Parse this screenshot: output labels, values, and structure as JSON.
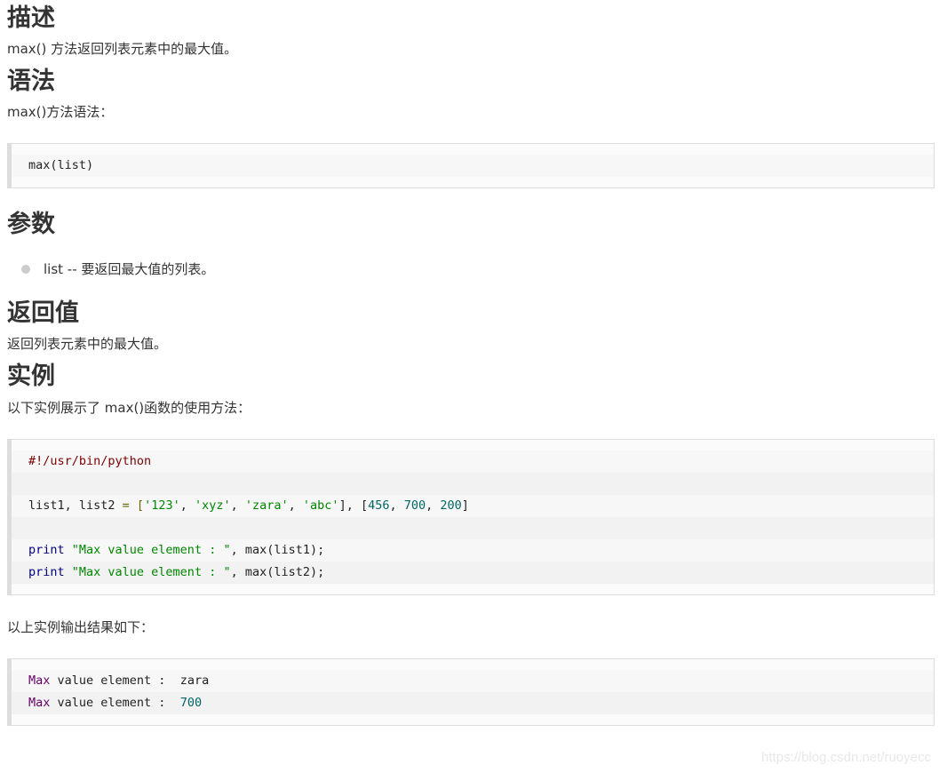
{
  "sections": {
    "description": {
      "heading": "描述",
      "text": "max() 方法返回列表元素中的最大值。"
    },
    "syntax": {
      "heading": "语法",
      "text": "max()方法语法：",
      "code": "max(list)"
    },
    "parameters": {
      "heading": "参数",
      "items": [
        {
          "text": "list -- 要返回最大值的列表。"
        }
      ]
    },
    "return_value": {
      "heading": "返回值",
      "text": "返回列表元素中的最大值。"
    },
    "example": {
      "heading": "实例",
      "text": "以下实例展示了 max()函数的使用方法：",
      "code": {
        "line1": "#!/usr/bin/python",
        "line3_a": "list1, list2 ",
        "line3_b": "= [",
        "line3_s1": "'123'",
        "line3_c1": ", ",
        "line3_s2": "'xyz'",
        "line3_c2": ", ",
        "line3_s3": "'zara'",
        "line3_c3": ", ",
        "line3_s4": "'abc'",
        "line3_d": "], [",
        "line3_n1": "456",
        "line3_c4": ", ",
        "line3_n2": "700",
        "line3_c5": ", ",
        "line3_n3": "200",
        "line3_e": "]",
        "line5_kw": "print",
        "line5_str": " \"Max value element : \"",
        "line5_rest": ", max(list1);",
        "line6_kw": "print",
        "line6_str": " \"Max value element : \"",
        "line6_rest": ", max(list2);"
      },
      "output_intro": "以上实例输出结果如下：",
      "output": {
        "line1_a": "Max",
        "line1_b": " value element :  zara",
        "line2_a": "Max",
        "line2_b": " value element :  ",
        "line2_c": "700"
      }
    }
  },
  "watermark": "https://blog.csdn.net/ruoyecc",
  "colors": {
    "heading": "#333333",
    "code_border": "#dddddd",
    "code_bg": "#fbfbfb",
    "string": "#008800",
    "number": "#006666",
    "keyword": "#000088",
    "comment": "#800000"
  }
}
